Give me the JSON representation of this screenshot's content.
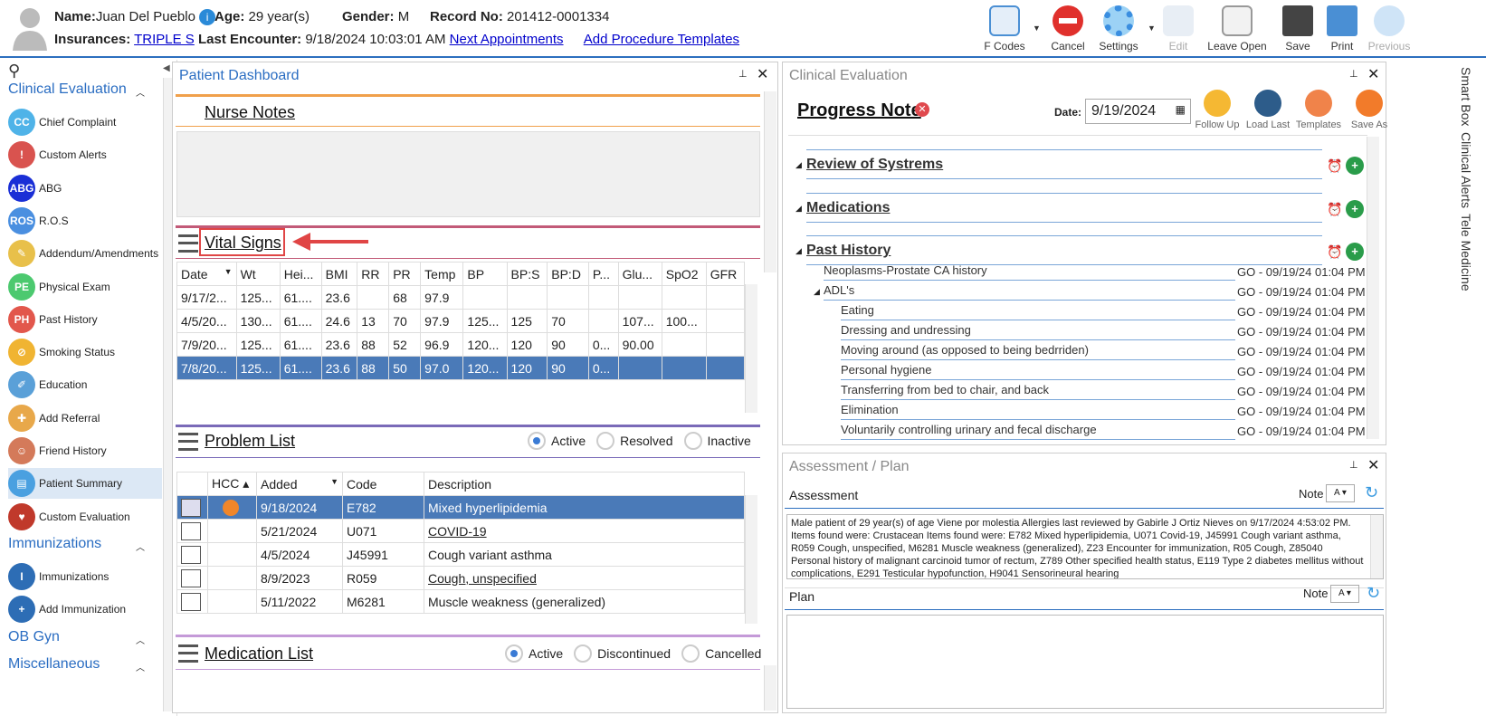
{
  "header": {
    "name_label": "Name:",
    "name": "Juan Del Pueblo",
    "age_label": "Age:",
    "age": "29 year(s)",
    "gender_label": "Gender:",
    "gender": "M",
    "record_label": "Record No:",
    "record": "201412-0001334",
    "ins_label": "Insurances:",
    "ins": "TRIPLE S",
    "last_label": "Last Encounter:",
    "last": "9/18/2024 10:03:01 AM",
    "next_link": "Next Appointments",
    "proc_link": "Add Procedure Templates"
  },
  "toolbar": {
    "fcodes": "F Codes",
    "cancel": "Cancel",
    "settings": "Settings",
    "edit": "Edit",
    "leave_open": "Leave Open",
    "save": "Save",
    "print": "Print",
    "previous": "Previous"
  },
  "sidebar": {
    "sec1": "Clinical Evaluation",
    "sec2": "Immunizations",
    "sec3": "OB Gyn",
    "sec4": "Miscellaneous",
    "items": [
      {
        "label": "Chief Complaint",
        "abbr": "CC",
        "color": "#4fb3e8"
      },
      {
        "label": "Custom Alerts",
        "abbr": "!",
        "color": "#d9534f"
      },
      {
        "label": "ABG",
        "abbr": "ABG",
        "color": "#1a2fd6"
      },
      {
        "label": "R.O.S",
        "abbr": "ROS",
        "color": "#4a8fe0"
      },
      {
        "label": "Addendum/Amendments",
        "abbr": "✎",
        "color": "#e8c04a"
      },
      {
        "label": "Physical Exam",
        "abbr": "PE",
        "color": "#4cc96f"
      },
      {
        "label": "Past History",
        "abbr": "PH",
        "color": "#e2574c"
      },
      {
        "label": "Smoking Status",
        "abbr": "⊘",
        "color": "#f0b432"
      },
      {
        "label": "Education",
        "abbr": "✐",
        "color": "#5aa0d8"
      },
      {
        "label": "Add Referral",
        "abbr": "✚",
        "color": "#e8a84a"
      },
      {
        "label": "Friend History",
        "abbr": "☺",
        "color": "#d47a5a"
      },
      {
        "label": "Patient Summary",
        "abbr": "▤",
        "color": "#4aa0e0"
      },
      {
        "label": "Custom Evaluation",
        "abbr": "♥",
        "color": "#c0392b"
      }
    ],
    "imm_items": [
      {
        "label": "Immunizations",
        "abbr": "I",
        "color": "#2d6db5"
      },
      {
        "label": "Add Immunization",
        "abbr": "+",
        "color": "#2d6db5"
      }
    ]
  },
  "dashboard": {
    "title": "Patient Dashboard",
    "nurse_notes": "Nurse Notes",
    "vital_title": "Vital Signs",
    "vital_cols": [
      "Date",
      "Wt",
      "Hei...",
      "BMI",
      "RR",
      "PR",
      "Temp",
      "BP",
      "BP:S",
      "BP:D",
      "P...",
      "Glu...",
      "SpO2",
      "GFR"
    ],
    "vital_rows": [
      [
        "9/17/2...",
        "125...",
        "61....",
        "23.6",
        "",
        "68",
        "97.9",
        "",
        "",
        "",
        "",
        "",
        "",
        ""
      ],
      [
        "4/5/20...",
        "130...",
        "61....",
        "24.6",
        "13",
        "70",
        "97.9",
        "125...",
        "125",
        "70",
        "",
        "107...",
        "100...",
        ""
      ],
      [
        "7/9/20...",
        "125...",
        "61....",
        "23.6",
        "88",
        "52",
        "96.9",
        "120...",
        "120",
        "90",
        "0...",
        "90.00",
        "",
        ""
      ],
      [
        "7/8/20...",
        "125...",
        "61....",
        "23.6",
        "88",
        "50",
        "97.0",
        "120...",
        "120",
        "90",
        "0...",
        "",
        "",
        ""
      ]
    ],
    "problem_title": "Problem List",
    "problem_filters": [
      "Active",
      "Resolved",
      "Inactive"
    ],
    "problem_cols": [
      "HCC",
      "Added",
      "Code",
      "Description"
    ],
    "problem_rows": [
      {
        "added": "9/18/2024",
        "code": "E782",
        "desc": "Mixed hyperlipidemia"
      },
      {
        "added": "5/21/2024",
        "code": "U071",
        "desc": "COVID-19"
      },
      {
        "added": "4/5/2024",
        "code": "J45991",
        "desc": "Cough variant asthma"
      },
      {
        "added": "8/9/2023",
        "code": "R059",
        "desc": "Cough, unspecified"
      },
      {
        "added": "5/11/2022",
        "code": "M6281",
        "desc": "Muscle weakness (generalized)"
      }
    ],
    "med_title": "Medication List",
    "med_filters": [
      "Active",
      "Discontinued",
      "Cancelled"
    ]
  },
  "clinical": {
    "panel_title": "Clinical Evaluation",
    "note_title": "Progress Note",
    "date_label": "Date:",
    "date": "9/19/2024",
    "actions": [
      "Follow Up",
      "Load Last",
      "Templates",
      "Save As"
    ],
    "sections": [
      "Review of Systrems",
      "Medications",
      "Past History"
    ],
    "history": [
      {
        "label": "Neoplasms-Prostate CA history",
        "stamp": "GO - 09/19/24 01:04 PM"
      },
      {
        "label": "ADL's",
        "stamp": "GO - 09/19/24 01:04 PM"
      },
      {
        "label": "Eating",
        "stamp": "GO - 09/19/24 01:04 PM"
      },
      {
        "label": "Dressing and undressing",
        "stamp": "GO - 09/19/24 01:04 PM"
      },
      {
        "label": "Moving around (as opposed to being bedrriden)",
        "stamp": "GO - 09/19/24 01:04 PM"
      },
      {
        "label": "Personal hygiene",
        "stamp": "GO - 09/19/24 01:04 PM"
      },
      {
        "label": "Transferring from bed to chair, and back",
        "stamp": "GO - 09/19/24 01:04 PM"
      },
      {
        "label": "Elimination",
        "stamp": "GO - 09/19/24 01:04 PM"
      },
      {
        "label": "Voluntarily controlling urinary and fecal discharge",
        "stamp": "GO - 09/19/24 01:04 PM"
      }
    ]
  },
  "assessment": {
    "panel_title": "Assessment / Plan",
    "assessment_label": "Assessment",
    "note_label": "Note",
    "text": "Male patient of 29 year(s) of age Viene por molestia     Allergies last reviewed by Gabirle J Ortiz Nieves on 9/17/2024 4:53:02 PM.    Items found were:  Crustacean  Items found were:  E782 Mixed hyperlipidemia, U071 Covid-19, J45991 Cough variant asthma, R059 Cough, unspecified, M6281 Muscle weakness (generalized), Z23 Encounter for immunization, R05 Cough, Z85040 Personal history of malignant carcinoid tumor of rectum, Z789 Other specified health status, E119 Type 2 diabetes mellitus without complications, E291 Testicular hypofunction, H9041 Sensorineural hearing",
    "plan_label": "Plan",
    "plan_note_label": "Note"
  },
  "right_tabs": [
    "Smart Box",
    "Clinical Alerts",
    "Tele Medicine"
  ]
}
